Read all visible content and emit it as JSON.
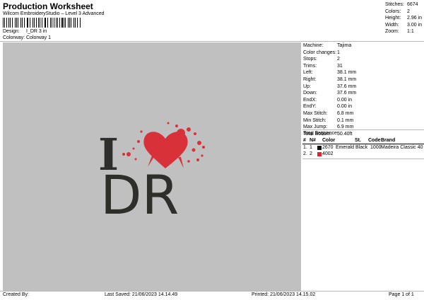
{
  "header": {
    "title": "Production Worksheet",
    "subtitle": "Wilcom EmbroideryStudio – Level 3 Advanced",
    "design_label": "Design:",
    "design_value": "I_DR 3 in",
    "colorway_label": "Colorway:",
    "colorway_value": "Colorway 1"
  },
  "summary": [
    {
      "label": "Stitches:",
      "value": "6674"
    },
    {
      "label": "Colors:",
      "value": "2"
    },
    {
      "label": "Height:",
      "value": "2.96 in"
    },
    {
      "label": "Width:",
      "value": "3.00 in"
    },
    {
      "label": "Zoom:",
      "value": "1:1"
    }
  ],
  "design_preview": {
    "letter_i": "I",
    "letters_dr": "DR",
    "thread_color": "#2e2f2b",
    "heart_color": "#d9313a"
  },
  "stats": [
    {
      "label": "Machine:",
      "value": "Tajima"
    },
    {
      "label": "Color changes:",
      "value": "1"
    },
    {
      "label": "Stops:",
      "value": "2"
    },
    {
      "label": "Trims:",
      "value": "31"
    },
    {
      "label": "Left:",
      "value": "38.1 mm"
    },
    {
      "label": "Right:",
      "value": "38.1 mm"
    },
    {
      "label": "Up:",
      "value": "37.6 mm"
    },
    {
      "label": "Down:",
      "value": "37.6 mm"
    },
    {
      "label": "EndX:",
      "value": "0.00 in"
    },
    {
      "label": "EndY:",
      "value": "0.00 in"
    },
    {
      "label": "Max Stitch:",
      "value": "6.8 mm"
    },
    {
      "label": "Min Stitch:",
      "value": "0.1 mm"
    },
    {
      "label": "Max Jump:",
      "value": "6.9 mm"
    },
    {
      "label": "Total Bobbin:",
      "value": "50.40ft"
    }
  ],
  "stop_sequence": {
    "title": "Stop Sequence:",
    "headers": [
      "#",
      "N#",
      "Color",
      "St.",
      "Code",
      "Brand"
    ],
    "rows": [
      {
        "num": "1.",
        "n": "1",
        "color_code": "2670",
        "color_name": "Emerald Black",
        "stitches": "1000",
        "brand": "Madeira Classic 40",
        "swatch": "#111111"
      },
      {
        "num": "2.",
        "n": "2",
        "color_code": "4002",
        "color_name": "",
        "stitches": "",
        "brand": "",
        "swatch": "#e0262b"
      }
    ]
  },
  "footer": {
    "created_by": "Created By:",
    "last_saved": "Last Saved: 21/06/2023 14.14.49",
    "printed": "Printed: 21/06/2023 14.15.02",
    "page": "Page 1 of 1"
  }
}
